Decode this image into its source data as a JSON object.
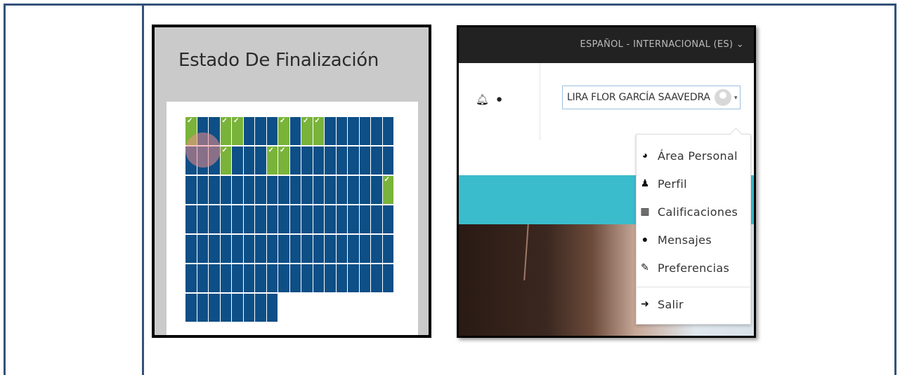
{
  "left_panel": {
    "title": "Estado De Finalización",
    "grid": {
      "columns": 18,
      "rows": [
        {
          "count": 18,
          "done": [
            0,
            3,
            4,
            8,
            10,
            11
          ]
        },
        {
          "count": 18,
          "done": [
            3,
            7,
            8
          ]
        },
        {
          "count": 18,
          "done": [
            17
          ]
        },
        {
          "count": 18,
          "done": []
        },
        {
          "count": 18,
          "done": []
        },
        {
          "count": 18,
          "done": []
        },
        {
          "count": 8,
          "done": []
        }
      ]
    },
    "colors": {
      "pending": "#0d4f86",
      "done": "#7ab33a"
    }
  },
  "right_panel": {
    "language": "ESPAÑOL - INTERNACIONAL (ES)",
    "language_caret": "⌄",
    "notification_icon": "bell-icon",
    "message_icon": "chat-icon",
    "user_name": "LIRA FLOR GARCÍA SAAVEDRA",
    "menu_caret": "▾",
    "user_menu": [
      {
        "icon": "dashboard-icon",
        "glyph": "◕",
        "label": "Área Personal"
      },
      {
        "icon": "user-icon",
        "glyph": "♟",
        "label": "Perfil"
      },
      {
        "icon": "table-icon",
        "glyph": "▦",
        "label": "Calificaciones"
      },
      {
        "icon": "chat-icon",
        "glyph": "●",
        "label": "Mensajes"
      },
      {
        "icon": "wrench-icon",
        "glyph": "✎",
        "label": "Preferencias"
      },
      {
        "icon": "sign-out-icon",
        "glyph": "➜",
        "label": "Salir"
      }
    ]
  }
}
